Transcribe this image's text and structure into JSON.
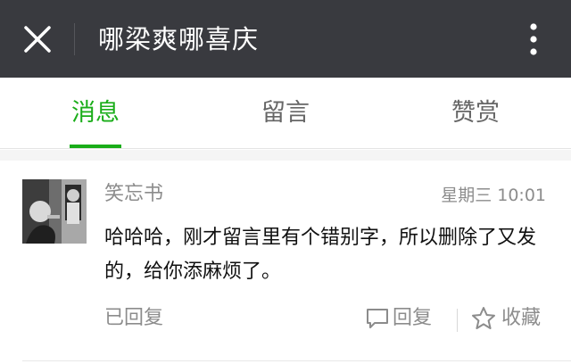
{
  "titlebar": {
    "title": "哪梁爽哪喜庆",
    "close_icon": "close-icon",
    "more_icon": "more-vertical-icon"
  },
  "tabs": [
    {
      "label": "消息",
      "active": true
    },
    {
      "label": "留言",
      "active": false
    },
    {
      "label": "赞赏",
      "active": false
    }
  ],
  "colors": {
    "titlebar_bg": "#393a3f",
    "accent": "#1aad19",
    "secondary_text": "#8c8c8c"
  },
  "message": {
    "nickname": "笑忘书",
    "time": "星期三 10:01",
    "text": "哈哈哈，刚才留言里有个错别字，所以删除了又发的，给你添麻烦了。",
    "status": "已回复",
    "reply_label": "回复",
    "favorite_label": "收藏",
    "reply_icon": "comment-bubble-icon",
    "favorite_icon": "star-outline-icon"
  }
}
